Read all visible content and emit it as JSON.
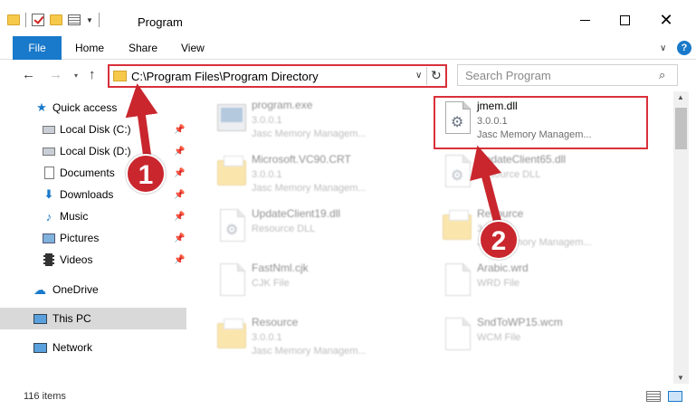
{
  "window": {
    "title": "Program",
    "minimize_glyph": "—",
    "close_glyph": "✕"
  },
  "ribbon": {
    "tabs": [
      {
        "label": "File"
      },
      {
        "label": "Home"
      },
      {
        "label": "Share"
      },
      {
        "label": "View"
      }
    ],
    "help_glyph": "?"
  },
  "navigation": {
    "back_glyph": "←",
    "forward_glyph": "→",
    "recent_glyph": "▾",
    "up_glyph": "↑",
    "address_path": "C:\\Program Files\\Program Directory",
    "search_placeholder": "Search Program"
  },
  "sidebar": {
    "items": [
      {
        "label": "Quick access",
        "icon": "star-icon",
        "pinned": false
      },
      {
        "label": "Local Disk (C:)",
        "icon": "drive-icon",
        "pinned": true
      },
      {
        "label": "Local Disk (D:)",
        "icon": "drive-icon",
        "pinned": true
      },
      {
        "label": "Documents",
        "icon": "documents-icon",
        "pinned": true
      },
      {
        "label": "Downloads",
        "icon": "download-icon",
        "pinned": true
      },
      {
        "label": "Music",
        "icon": "music-icon",
        "pinned": true
      },
      {
        "label": "Pictures",
        "icon": "pictures-icon",
        "pinned": true
      },
      {
        "label": "Videos",
        "icon": "videos-icon",
        "pinned": true
      },
      {
        "label": "OneDrive",
        "icon": "cloud-icon",
        "pinned": false
      },
      {
        "label": "This PC",
        "icon": "computer-icon",
        "pinned": false,
        "selected": true
      },
      {
        "label": "Network",
        "icon": "network-icon",
        "pinned": false
      }
    ]
  },
  "files": [
    {
      "name": "program.exe",
      "line1": "3.0.0.1",
      "line2": "Jasc Memory Managem...",
      "type": "exe"
    },
    {
      "name": "jmem.dll",
      "line1": "3.0.0.1",
      "line2": "Jasc Memory Managem...",
      "type": "dll",
      "highlighted": true
    },
    {
      "name": "Microsoft.VC90.CRT",
      "line1": "3.0.0.1",
      "line2": "Jasc Memory Managem...",
      "type": "folder"
    },
    {
      "name": "UpdateClient65.dll",
      "line1": "Resource DLL",
      "line2": "",
      "type": "dll"
    },
    {
      "name": "UpdateClient19.dll",
      "line1": "Resource DLL",
      "line2": "",
      "type": "dll"
    },
    {
      "name": "Resource",
      "line1": "3.0.0.1",
      "line2": "Jasc Memory Managem...",
      "type": "folder"
    },
    {
      "name": "FastNml.cjk",
      "line1": "CJK File",
      "line2": "",
      "type": "doc"
    },
    {
      "name": "Arabic.wrd",
      "line1": "WRD File",
      "line2": "",
      "type": "doc"
    },
    {
      "name": "Resource",
      "line1": "3.0.0.1",
      "line2": "Jasc Memory Managem...",
      "type": "folder"
    },
    {
      "name": "SndToWP15.wcm",
      "line1": "WCM File",
      "line2": "",
      "type": "doc"
    }
  ],
  "status": {
    "item_count": "116 items"
  },
  "annotations": {
    "step1": "1",
    "step2": "2"
  },
  "colors": {
    "accent": "#1979ca",
    "annotation_red": "#d9303a",
    "folder_yellow": "#f6c94b"
  }
}
